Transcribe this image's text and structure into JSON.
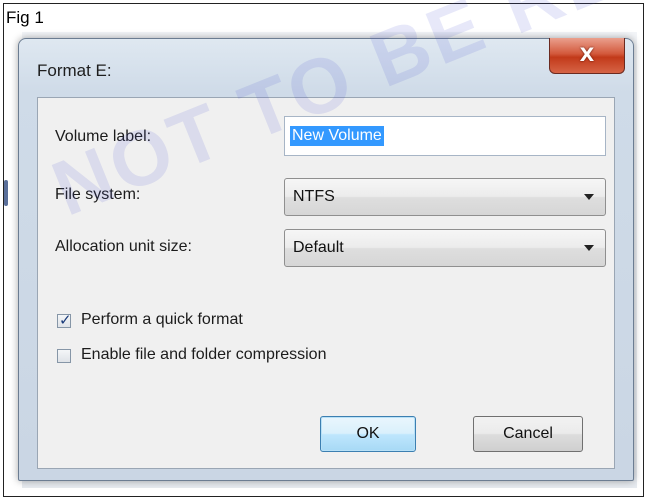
{
  "figure": {
    "caption": "Fig 1"
  },
  "watermark": {
    "text": "NOT TO BE REPUBLISHED"
  },
  "dialog": {
    "title": "Format E:",
    "close_label": "X",
    "volume_label": {
      "label": "Volume label:",
      "value": "New Volume"
    },
    "file_system": {
      "label": "File system:",
      "value": "NTFS"
    },
    "allocation_unit_size": {
      "label": "Allocation unit size:",
      "value": "Default"
    },
    "quick_format": {
      "label": "Perform a quick format",
      "checked": true
    },
    "compression": {
      "label": "Enable file and folder compression",
      "checked": false
    },
    "buttons": {
      "ok": "OK",
      "cancel": "Cancel"
    }
  }
}
